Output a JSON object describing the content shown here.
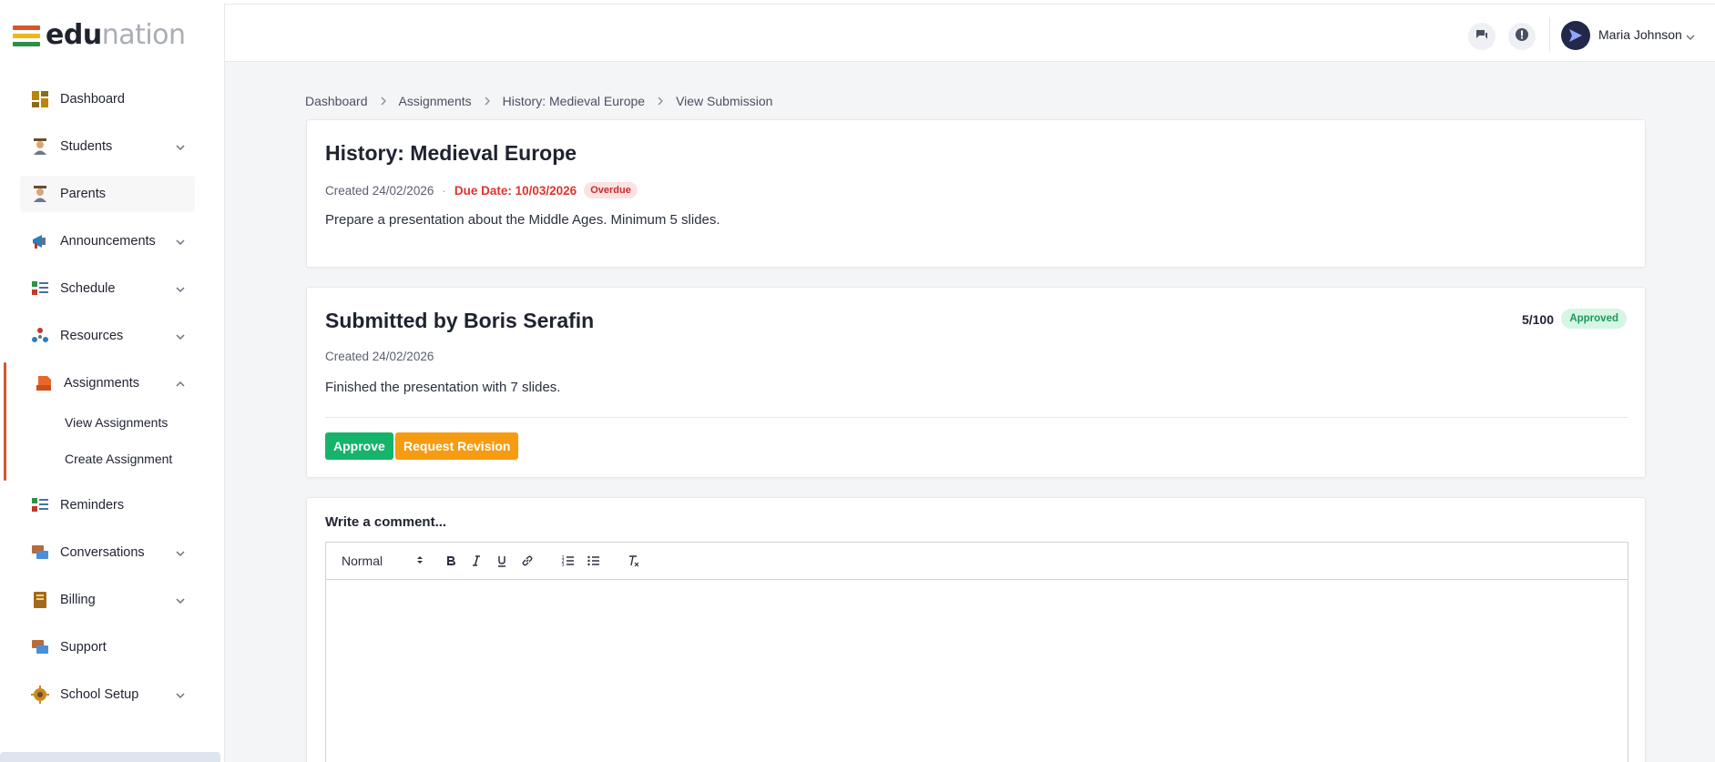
{
  "app": {
    "logo": {
      "part1": "edu",
      "part2": "nation"
    },
    "brand_colors": [
      "#d9542a",
      "#f2b41b",
      "#2f8f48"
    ]
  },
  "sidebar": {
    "items": [
      {
        "label": "Dashboard",
        "icon": "dashboard-icon",
        "has_chevron": false
      },
      {
        "label": "Students",
        "icon": "student-icon",
        "has_chevron": true
      },
      {
        "label": "Parents",
        "icon": "parent-icon",
        "has_chevron": false
      },
      {
        "label": "Announcements",
        "icon": "megaphone-icon",
        "has_chevron": true
      },
      {
        "label": "Schedule",
        "icon": "schedule-icon",
        "has_chevron": true
      },
      {
        "label": "Resources",
        "icon": "resources-icon",
        "has_chevron": true
      },
      {
        "label": "Assignments",
        "icon": "assignment-icon",
        "has_chevron": true,
        "expanded": true
      },
      {
        "label": "Reminders",
        "icon": "reminders-icon",
        "has_chevron": false
      },
      {
        "label": "Conversations",
        "icon": "conversations-icon",
        "has_chevron": true
      },
      {
        "label": "Billing",
        "icon": "billing-icon",
        "has_chevron": true
      },
      {
        "label": "Support",
        "icon": "support-icon",
        "has_chevron": false
      },
      {
        "label": "School Setup",
        "icon": "gear-icon",
        "has_chevron": true
      }
    ],
    "assignments_sub": [
      "View Assignments",
      "Create Assignment"
    ]
  },
  "header": {
    "user_name": "Maria Johnson",
    "icons": [
      "chat-icon",
      "alert-icon",
      "chevron-down-icon"
    ]
  },
  "breadcrumb": [
    "Dashboard",
    "Assignments",
    "History: Medieval Europe",
    "View Submission"
  ],
  "assignment": {
    "title": "History: Medieval Europe",
    "created": "Created 24/02/2026",
    "due": "Due Date: 10/03/2026",
    "status": "Overdue",
    "description": "Prepare a presentation about the Middle Ages. Minimum 5 slides."
  },
  "submission": {
    "title": "Submitted by Boris Serafin",
    "created": "Created 24/02/2026",
    "text": "Finished the presentation with 7 slides.",
    "score": "5/100",
    "status": "Approved",
    "approve_label": "Approve",
    "revision_label": "Request Revision"
  },
  "comment": {
    "title": "Write a comment...",
    "format_value": "Normal",
    "toolbar": [
      "bold-icon",
      "italic-icon",
      "underline-icon",
      "link-icon",
      "ordered-list-icon",
      "bullet-list-icon",
      "clear-format-icon"
    ]
  }
}
